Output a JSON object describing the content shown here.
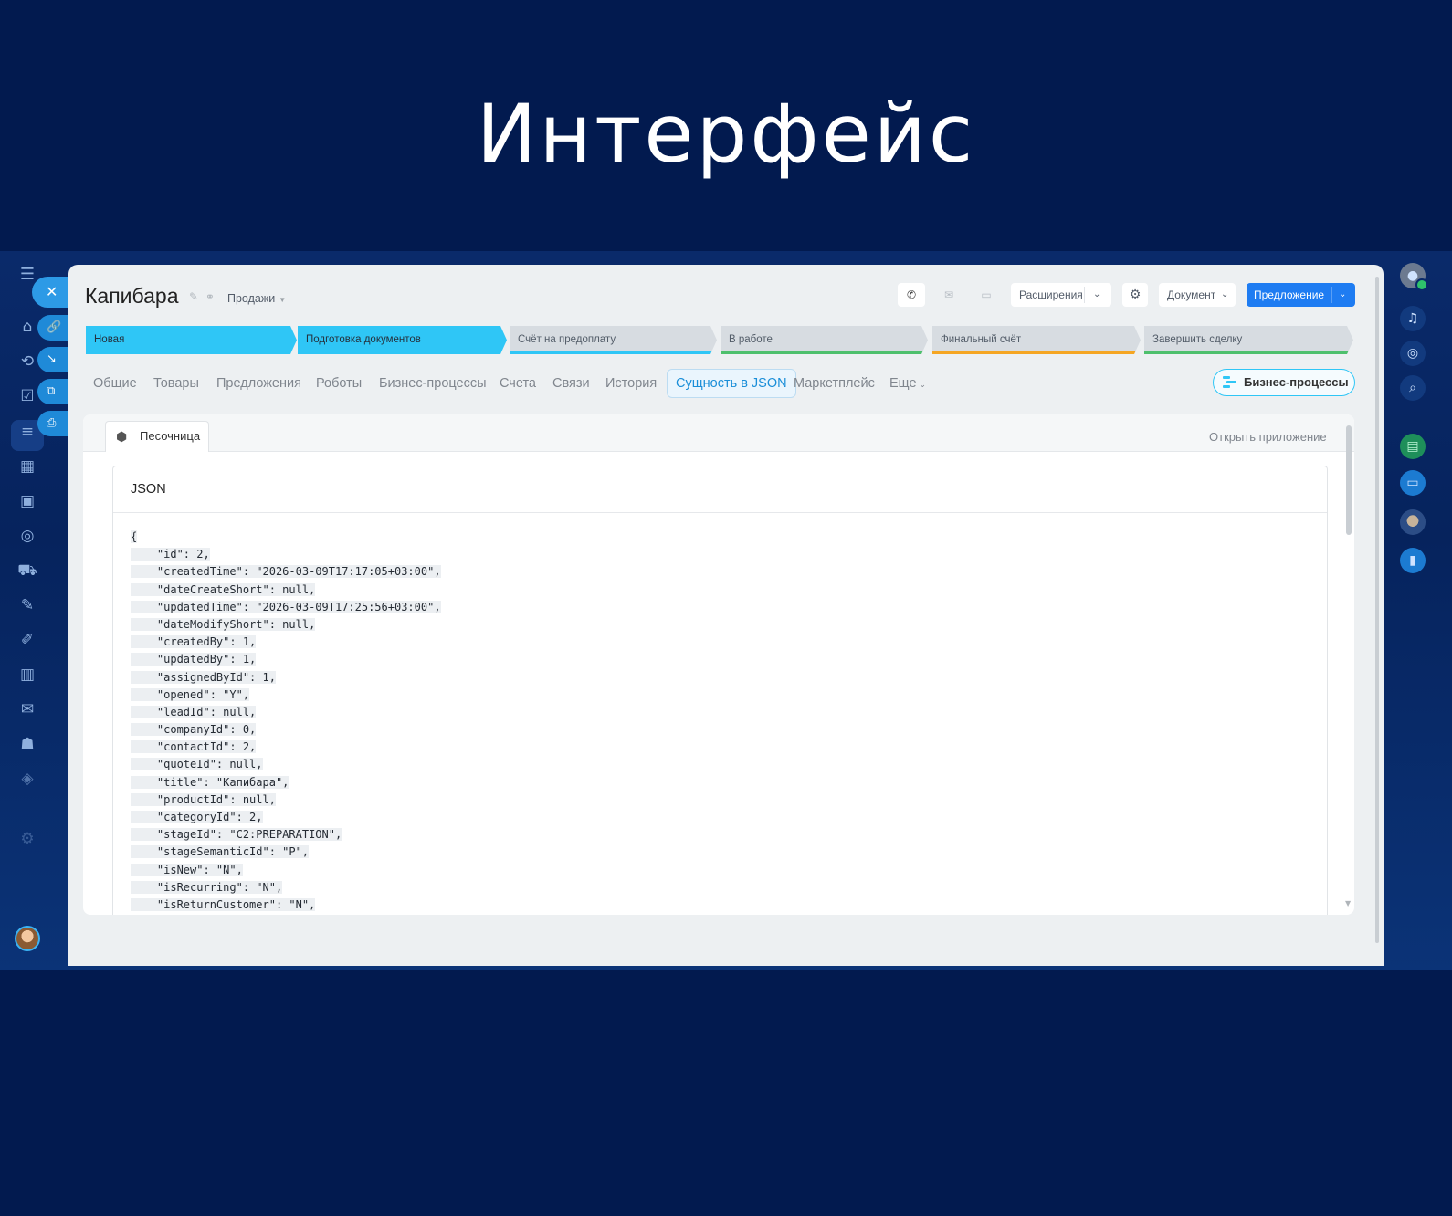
{
  "hero": {
    "title": "Интерфейс"
  },
  "colors": {
    "background": "#021a4f",
    "accent": "#2fc6f6",
    "primary_button": "#1e7cf2",
    "active_tab": "#1a8ed8"
  },
  "sidebar_left": {
    "icons": [
      "menu-icon",
      "home-icon",
      "workflow-icon",
      "tasks-icon",
      "crm-funnel-icon",
      "calendar-icon",
      "store-icon",
      "target-icon",
      "cart-icon",
      "sign-icon",
      "edit-icon",
      "analytics-icon",
      "mail-icon",
      "robot-icon",
      "box-icon",
      "settings-icon"
    ],
    "floating_actions": [
      "close-icon",
      "link-icon",
      "arrow-down-right-icon",
      "external-link-icon",
      "print-icon"
    ]
  },
  "sidebar_right": {
    "icons": [
      "user-avatar-icon",
      "bell-icon",
      "target-icon",
      "chat-search-icon",
      "book-icon",
      "chat-icon",
      "photo-avatar-icon",
      "bookmark-icon"
    ]
  },
  "header": {
    "title": "Капибара",
    "category": "Продажи",
    "toolbar": {
      "extensions": "Расширения",
      "document": "Документ",
      "offer": "Предложение"
    }
  },
  "stages": [
    {
      "label": "Новая",
      "state": "done"
    },
    {
      "label": "Подготовка документов",
      "state": "done"
    },
    {
      "label": "Счёт на предоплату",
      "state": "todo",
      "color": "#2fc6f6"
    },
    {
      "label": "В работе",
      "state": "todo",
      "color": "#4ec06d"
    },
    {
      "label": "Финальный счёт",
      "state": "todo",
      "color": "#f5a623"
    },
    {
      "label": "Завершить сделку",
      "state": "todo",
      "color": "#4ec06d"
    }
  ],
  "tabs": [
    "Общие",
    "Товары",
    "Предложения",
    "Роботы",
    "Бизнес-процессы",
    "Счета",
    "Связи",
    "История",
    "Сущность в JSON",
    "Маркетплейс",
    "Еще"
  ],
  "active_tab": "Сущность в JSON",
  "business_process_button": "Бизнес-процессы",
  "panel": {
    "sandbox_tab": "Песочница",
    "open_app": "Открыть приложение",
    "json_title": "JSON",
    "code_lines": [
      "{",
      "    \"id\": 2,",
      "    \"createdTime\": \"2026-03-09T17:17:05+03:00\",",
      "    \"dateCreateShort\": null,",
      "    \"updatedTime\": \"2026-03-09T17:25:56+03:00\",",
      "    \"dateModifyShort\": null,",
      "    \"createdBy\": 1,",
      "    \"updatedBy\": 1,",
      "    \"assignedById\": 1,",
      "    \"opened\": \"Y\",",
      "    \"leadId\": null,",
      "    \"companyId\": 0,",
      "    \"contactId\": 2,",
      "    \"quoteId\": null,",
      "    \"title\": \"Капибара\",",
      "    \"productId\": null,",
      "    \"categoryId\": 2,",
      "    \"stageId\": \"C2:PREPARATION\",",
      "    \"stageSemanticId\": \"P\",",
      "    \"isNew\": \"N\",",
      "    \"isRecurring\": \"N\",",
      "    \"isReturnCustomer\": \"N\","
    ]
  }
}
